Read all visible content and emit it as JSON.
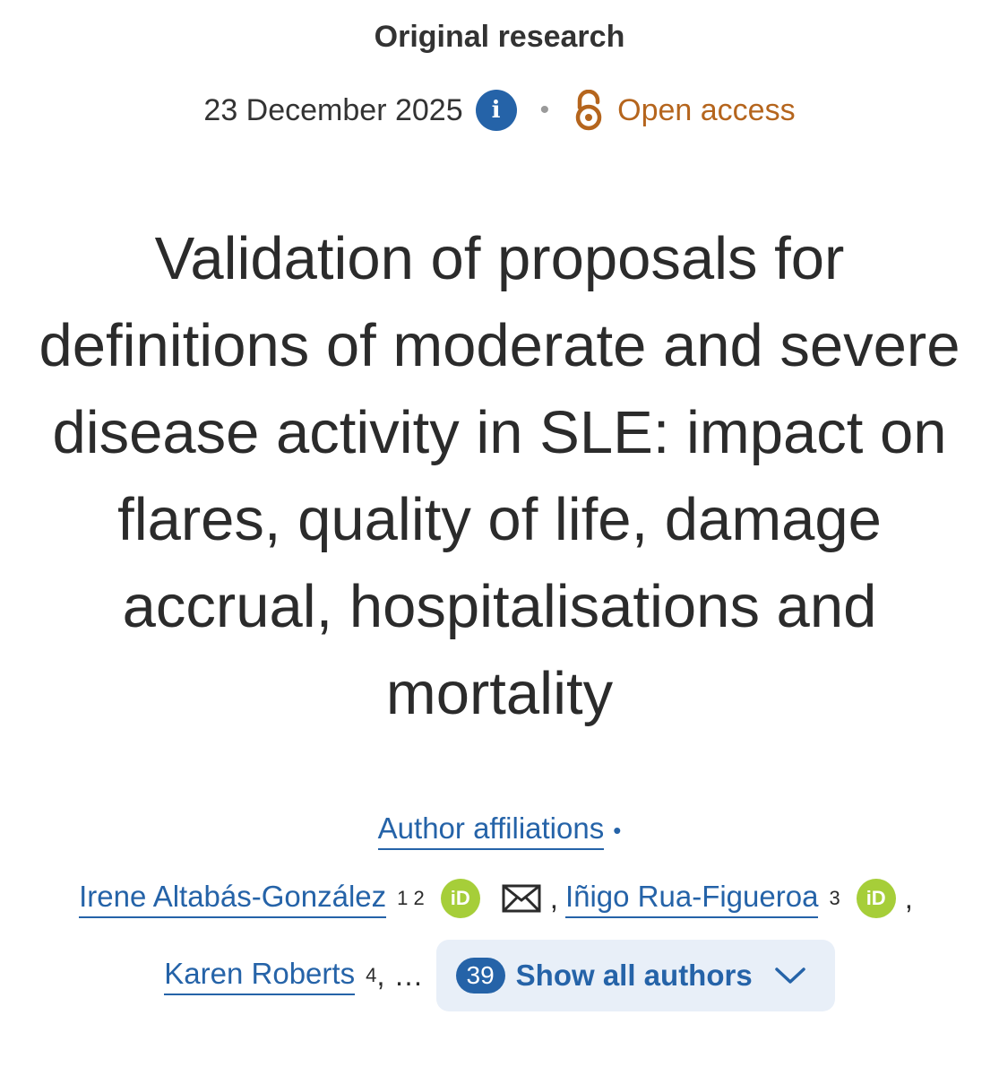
{
  "header": {
    "article_type": "Original research",
    "date": "23 December 2025",
    "info_icon": "i",
    "separator": "•",
    "access_label": "Open access",
    "colors": {
      "info": "#2563a8",
      "open_access": "#b5651d"
    }
  },
  "article": {
    "title": "Validation of proposals for definitions of moderate and severe disease activity in SLE: impact on flares, quality of life, damage accrual, hospitalisations and mortality"
  },
  "affiliations": {
    "link_label": "Author affiliations",
    "dot": "•"
  },
  "authors": [
    {
      "name": "Irene Altabás-González",
      "affil": "1 2",
      "orcid": "iD",
      "email": true
    },
    {
      "name": "Iñigo Rua-Figueroa",
      "affil": "3",
      "orcid": "iD"
    },
    {
      "name": "Karen Roberts",
      "affil": "4"
    }
  ],
  "authors_extra": {
    "comma": ",",
    "ellipsis": "…",
    "total_count": "39",
    "show_all_label": "Show all authors"
  },
  "colors": {
    "link": "#2563a8",
    "orcid": "#a6ce39",
    "button_bg": "#e8eff8"
  }
}
